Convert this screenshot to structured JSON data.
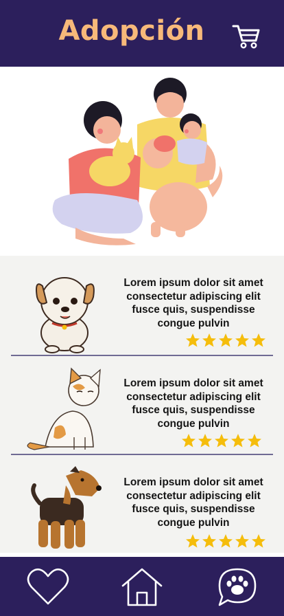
{
  "header": {
    "title": "Adopción",
    "cart_icon": "shopping-cart-icon"
  },
  "hero": {
    "image": "family-with-pets-illustration"
  },
  "pets": [
    {
      "image": "puppy-illustration",
      "description": "Lorem ipsum dolor sit amet consectetur adipiscing elit fusce quis, suspendisse congue pulvin",
      "rating": 5
    },
    {
      "image": "cat-illustration",
      "description": "Lorem ipsum dolor sit amet consectetur adipiscing elit fusce quis, suspendisse congue pulvin",
      "rating": 5
    },
    {
      "image": "terrier-dog-illustration",
      "description": "Lorem ipsum dolor sit amet consectetur adipiscing elit fusce quis, suspendisse congue pulvin",
      "rating": 5
    }
  ],
  "nav": {
    "favorites_icon": "heart-icon",
    "home_icon": "home-icon",
    "pets_icon": "paw-chat-icon"
  },
  "colors": {
    "primary": "#2c1f5c",
    "title": "#f7b97a",
    "star": "#f5bd0c",
    "list_bg": "#f3f3f1"
  }
}
